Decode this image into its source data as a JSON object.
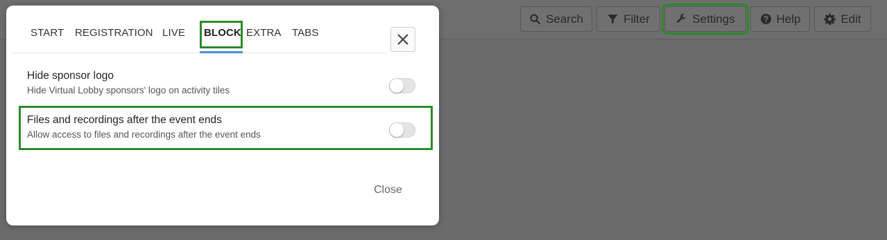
{
  "toolbar": {
    "buttons": [
      {
        "label": "Search",
        "icon": "search-icon"
      },
      {
        "label": "Filter",
        "icon": "filter-icon"
      },
      {
        "label": "Settings",
        "icon": "wrench-icon"
      },
      {
        "label": "Help",
        "icon": "question-circle-icon"
      },
      {
        "label": "Edit",
        "icon": "gear-icon"
      }
    ]
  },
  "modal": {
    "tabs": [
      {
        "label": "START"
      },
      {
        "label": "REGISTRATION"
      },
      {
        "label": "LIVE"
      },
      {
        "label": "BLOCK",
        "active": true
      },
      {
        "label": "EXTRA"
      },
      {
        "label": "TABS"
      }
    ],
    "settings": [
      {
        "title": "Hide sponsor logo",
        "description": "Hide Virtual Lobby sponsors' logo on activity tiles",
        "enabled": false
      },
      {
        "title": "Files and recordings after the event ends",
        "description": "Allow access to files and recordings after the event ends",
        "enabled": false
      }
    ],
    "close_label": "Close"
  },
  "colors": {
    "highlight": "#2c8a2c",
    "active_tab_underline": "#4a90d9",
    "overlay": "#6b6b6b"
  }
}
